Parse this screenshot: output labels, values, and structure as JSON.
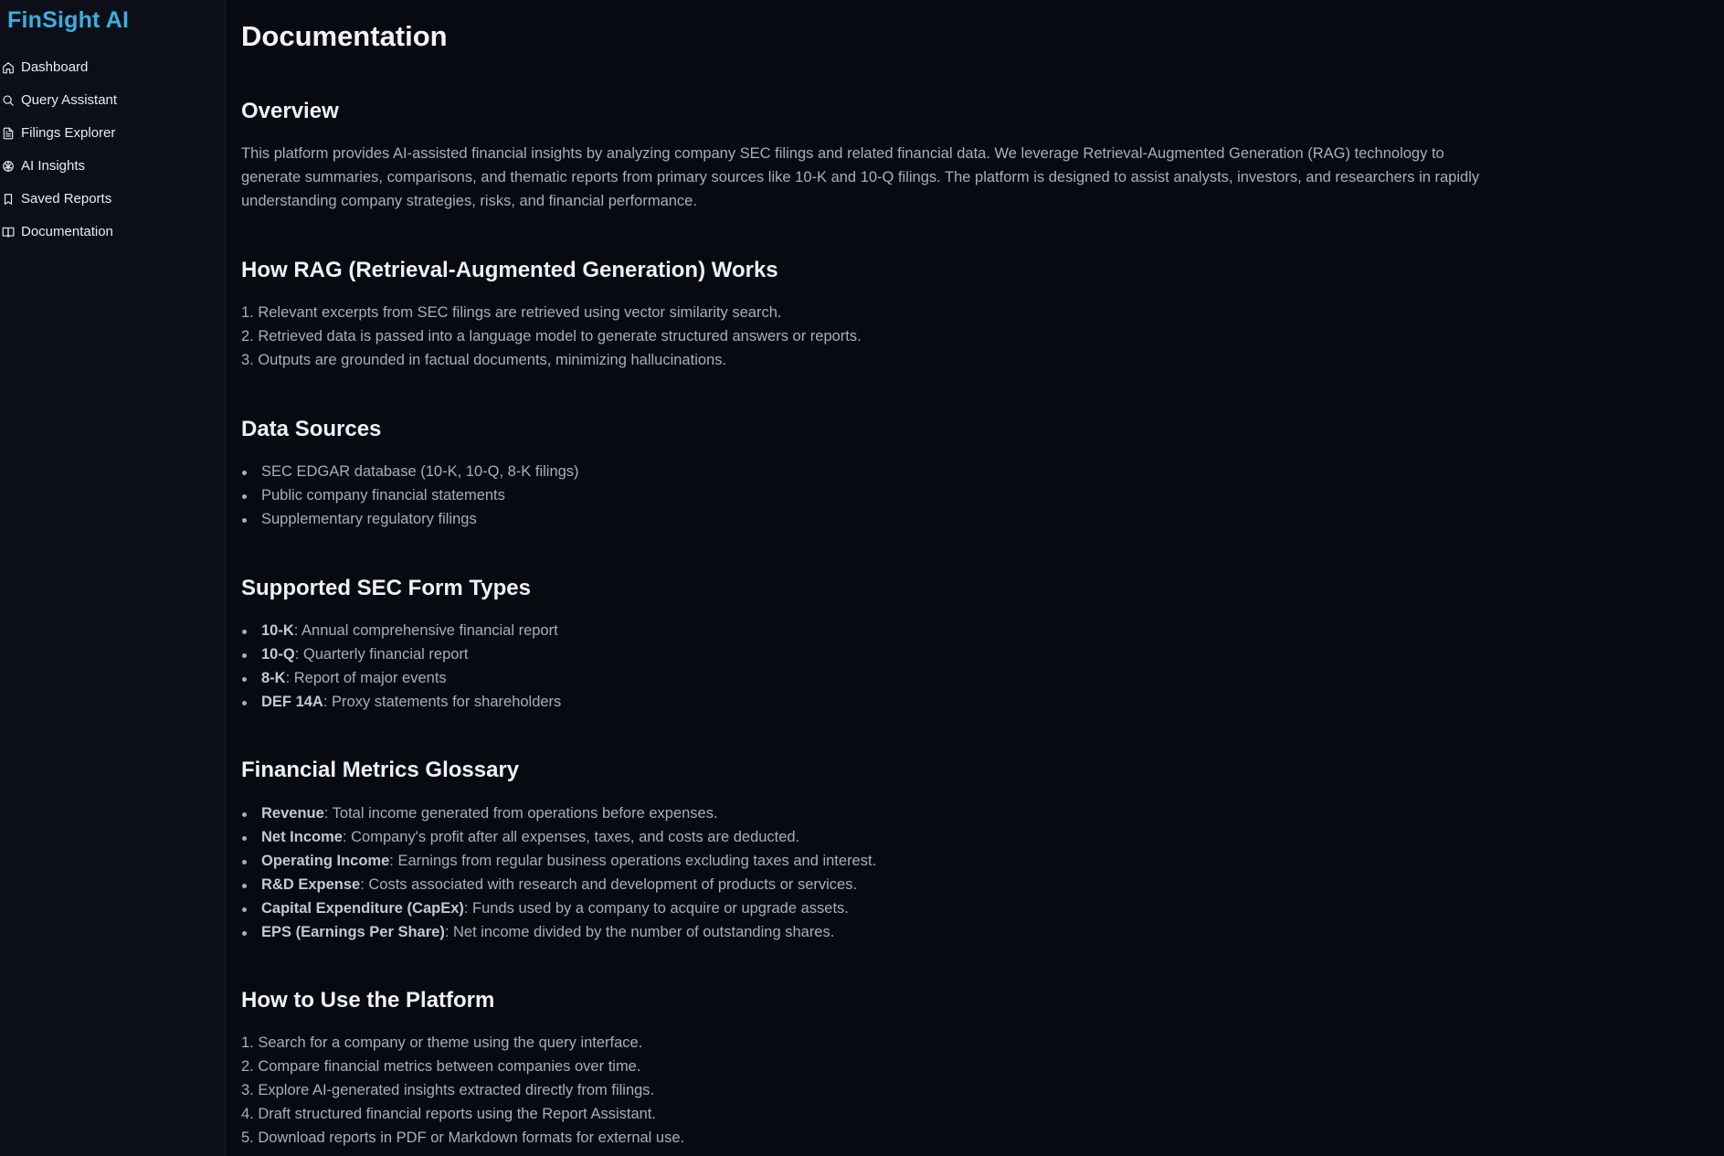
{
  "brand": "FinSight AI",
  "nav": [
    {
      "label": "Dashboard",
      "icon": "home-icon"
    },
    {
      "label": "Query Assistant",
      "icon": "search-icon"
    },
    {
      "label": "Filings Explorer",
      "icon": "file-icon"
    },
    {
      "label": "AI Insights",
      "icon": "brain-icon"
    },
    {
      "label": "Saved Reports",
      "icon": "bookmark-icon"
    },
    {
      "label": "Documentation",
      "icon": "book-icon"
    }
  ],
  "page_title": "Documentation",
  "overview": {
    "title": "Overview",
    "text": "This platform provides AI-assisted financial insights by analyzing company SEC filings and related financial data. We leverage Retrieval-Augmented Generation (RAG) technology to generate summaries, comparisons, and thematic reports from primary sources like 10-K and 10-Q filings. The platform is designed to assist analysts, investors, and researchers in rapidly understanding company strategies, risks, and financial performance."
  },
  "rag": {
    "title": "How RAG (Retrieval-Augmented Generation) Works",
    "steps": [
      "1. Relevant excerpts from SEC filings are retrieved using vector similarity search.",
      "2. Retrieved data is passed into a language model to generate structured answers or reports.",
      "3. Outputs are grounded in factual documents, minimizing hallucinations."
    ]
  },
  "data_sources": {
    "title": "Data Sources",
    "items": [
      "SEC EDGAR database (10-K, 10-Q, 8-K filings)",
      "Public company financial statements",
      "Supplementary regulatory filings"
    ]
  },
  "form_types": {
    "title": "Supported SEC Form Types",
    "items": [
      {
        "term": "10-K",
        "desc": ": Annual comprehensive financial report"
      },
      {
        "term": "10-Q",
        "desc": ": Quarterly financial report"
      },
      {
        "term": "8-K",
        "desc": ": Report of major events"
      },
      {
        "term": "DEF 14A",
        "desc": ": Proxy statements for shareholders"
      }
    ]
  },
  "glossary": {
    "title": "Financial Metrics Glossary",
    "items": [
      {
        "term": "Revenue",
        "desc": ": Total income generated from operations before expenses."
      },
      {
        "term": "Net Income",
        "desc": ": Company's profit after all expenses, taxes, and costs are deducted."
      },
      {
        "term": "Operating Income",
        "desc": ": Earnings from regular business operations excluding taxes and interest."
      },
      {
        "term": "R&D Expense",
        "desc": ": Costs associated with research and development of products or services."
      },
      {
        "term": "Capital Expenditure (CapEx)",
        "desc": ": Funds used by a company to acquire or upgrade assets."
      },
      {
        "term": "EPS (Earnings Per Share)",
        "desc": ": Net income divided by the number of outstanding shares."
      }
    ]
  },
  "usage": {
    "title": "How to Use the Platform",
    "steps": [
      "1. Search for a company or theme using the query interface.",
      "2. Compare financial metrics between companies over time.",
      "3. Explore AI-generated insights extracted directly from filings.",
      "4. Draft structured financial reports using the Report Assistant.",
      "5. Download reports in PDF or Markdown formats for external use."
    ]
  },
  "colors": {
    "background": "#080a12",
    "sidebar": "#0d0f18",
    "brand": "#3aaee0",
    "heading": "#eef1f6",
    "body_text": "#a7aebd"
  }
}
